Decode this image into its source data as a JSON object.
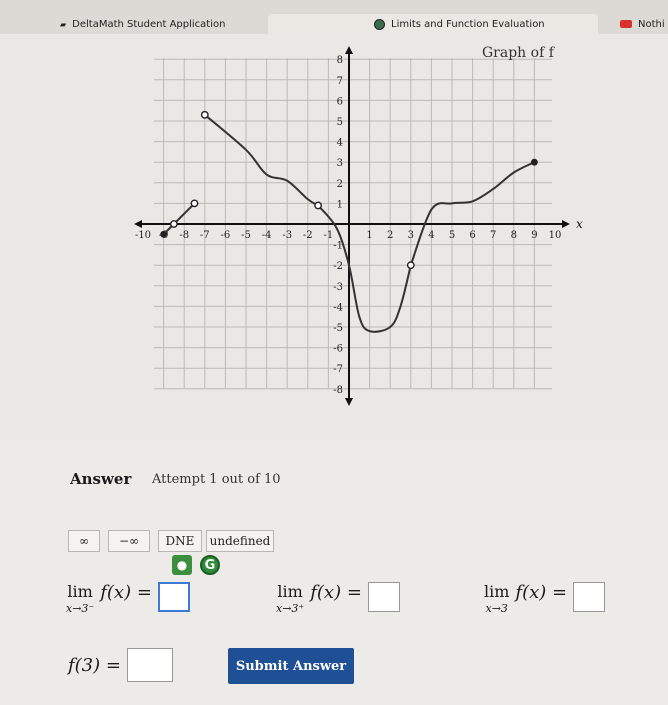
{
  "tabs": [
    {
      "label": "DeltaMath Student Application"
    },
    {
      "label": "Limits and Function Evaluation"
    },
    {
      "label": "Nothi"
    }
  ],
  "graph": {
    "title": "Graph of f",
    "x_label": "x",
    "x_ticks": [
      "-10",
      "-9",
      "-8",
      "-7",
      "-6",
      "-5",
      "-4",
      "-3",
      "-2",
      "-1",
      "1",
      "2",
      "3",
      "4",
      "5",
      "6",
      "7",
      "8",
      "9",
      "10"
    ],
    "y_ticks": [
      "8",
      "7",
      "6",
      "5",
      "4",
      "3",
      "2",
      "1",
      "-1",
      "-2",
      "-3",
      "-4",
      "-5",
      "-6",
      "-7",
      "-8"
    ]
  },
  "chart_data": {
    "type": "line",
    "title": "Graph of f",
    "xlabel": "x",
    "ylabel": "",
    "xlim": [
      -10,
      10
    ],
    "ylim": [
      -8,
      8
    ],
    "series": [
      {
        "points": [
          [
            -9,
            -0.5
          ],
          [
            -8.5,
            0
          ]
        ]
      },
      {
        "points": [
          [
            -8.5,
            0
          ],
          [
            -7.5,
            1
          ]
        ]
      },
      {
        "points": [
          [
            -7,
            5.3
          ],
          [
            -5,
            3.6
          ],
          [
            -4,
            2.4
          ],
          [
            -3,
            2.1
          ],
          [
            -2,
            1.2
          ],
          [
            -1.5,
            0.9
          ]
        ]
      },
      {
        "points": [
          [
            -1.5,
            0.9
          ],
          [
            -0.6,
            -0.2
          ],
          [
            0,
            -2
          ],
          [
            0.5,
            -4.5
          ],
          [
            1,
            -5.2
          ],
          [
            2,
            -5
          ],
          [
            2.5,
            -4
          ],
          [
            3,
            -2
          ]
        ]
      },
      {
        "points": [
          [
            3,
            -2
          ],
          [
            4,
            0.7
          ],
          [
            5,
            1
          ],
          [
            6,
            1.1
          ],
          [
            7,
            1.7
          ],
          [
            8,
            2.5
          ],
          [
            9,
            3
          ]
        ]
      }
    ],
    "open_points": [
      [
        -8.5,
        0
      ],
      [
        -7.5,
        1
      ],
      [
        -7,
        5.3
      ],
      [
        -1.5,
        0.9
      ],
      [
        3,
        -2
      ]
    ],
    "closed_points": [
      [
        -9,
        -0.5
      ],
      [
        9,
        3
      ]
    ]
  },
  "answer": {
    "title": "Answer",
    "attempt": "Attempt 1 out of 10",
    "chips": [
      "∞",
      "−∞",
      "DNE",
      "undefined"
    ],
    "helper_g": "G",
    "limits": [
      {
        "word": "lim",
        "sub": "x→3⁻",
        "expr": "f(x) ="
      },
      {
        "word": "lim",
        "sub": "x→3⁺",
        "expr": "f(x) ="
      },
      {
        "word": "lim",
        "sub": "x→3",
        "expr": "f(x) ="
      }
    ],
    "f3": "f(3) =",
    "submit": "Submit Answer"
  }
}
